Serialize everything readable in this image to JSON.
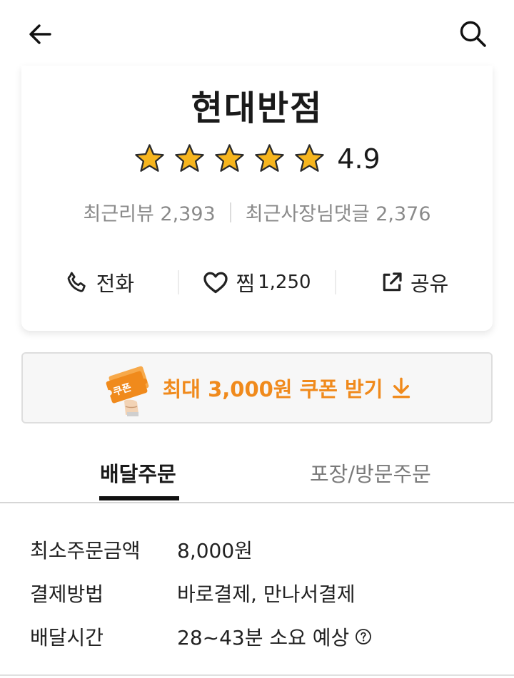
{
  "header": {
    "back_icon": "arrow-left-icon",
    "search_icon": "search-icon"
  },
  "store": {
    "name": "현대반점",
    "rating": "4.9",
    "rating_stars": 5,
    "star_color": "#f6b51e",
    "recent_reviews_label": "최근리뷰 2,393",
    "owner_replies_label": "최근사장님댓글 2,376"
  },
  "actions": {
    "call_label": "전화",
    "like_label": "찜",
    "like_count": "1,250",
    "share_label": "공유"
  },
  "coupon": {
    "badge_text": "쿠폰",
    "label": "최대 3,000원 쿠폰 받기",
    "accent_color": "#f08a1c"
  },
  "tabs": [
    {
      "label": "배달주문",
      "active": true
    },
    {
      "label": "포장/방문주문",
      "active": false
    }
  ],
  "info": [
    {
      "label": "최소주문금액",
      "value": "8,000원"
    },
    {
      "label": "결제방법",
      "value": "바로결제, 만나서결제"
    },
    {
      "label": "배달시간",
      "value": "28~43분 소요 예상"
    }
  ]
}
